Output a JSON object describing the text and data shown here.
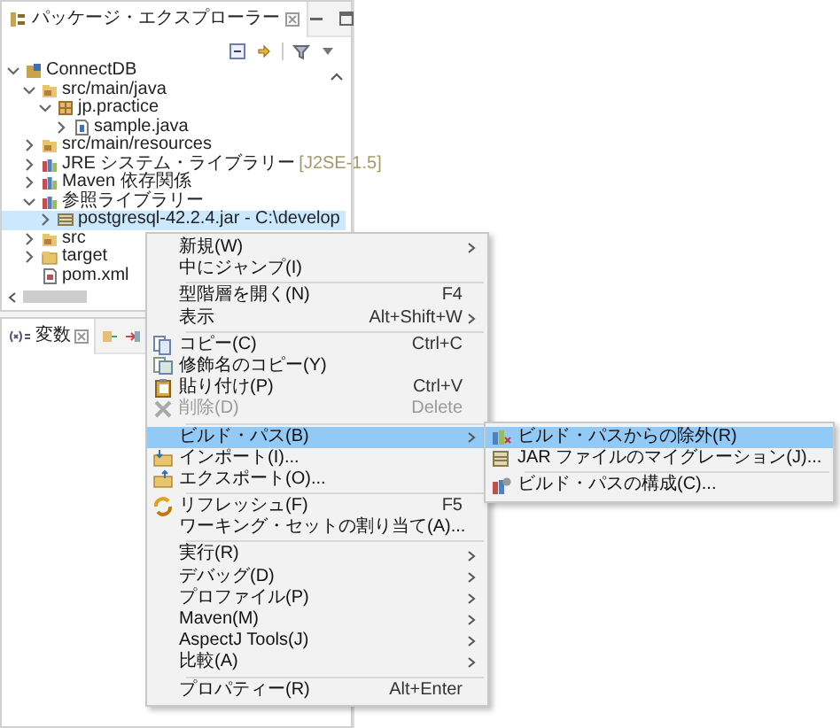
{
  "package_explorer": {
    "title": "パッケージ・エクスプローラー",
    "tree": [
      {
        "label": "ConnectDB",
        "kind": "project",
        "expanded": true,
        "selected": false,
        "children": [
          {
            "label": "src/main/java",
            "kind": "source-folder",
            "expanded": true,
            "selected": false,
            "children": [
              {
                "label": "jp.practice",
                "kind": "package",
                "expanded": true,
                "selected": false,
                "children": [
                  {
                    "label": "sample.java",
                    "kind": "java-file",
                    "expanded": false,
                    "selected": false
                  }
                ]
              }
            ]
          },
          {
            "label": "src/main/resources",
            "kind": "source-folder",
            "expanded": false,
            "selected": false
          },
          {
            "label": "JRE システム・ライブラリー",
            "decoration": "[J2SE-1.5]",
            "kind": "library",
            "expanded": false,
            "selected": false
          },
          {
            "label": "Maven 依存関係",
            "kind": "library",
            "expanded": false,
            "selected": false
          },
          {
            "label": "参照ライブラリー",
            "kind": "library",
            "expanded": true,
            "selected": false,
            "children": [
              {
                "label": "postgresql-42.2.4.jar - C:\\develop",
                "kind": "jar",
                "expanded": false,
                "selected": true
              }
            ]
          },
          {
            "label": "src",
            "kind": "source-folder",
            "expanded": false,
            "selected": false
          },
          {
            "label": "target",
            "kind": "folder",
            "expanded": false,
            "selected": false
          },
          {
            "label": "pom.xml",
            "kind": "xml-file",
            "selected": false
          }
        ]
      }
    ]
  },
  "variables_view": {
    "title": "変数"
  },
  "context_menu": {
    "items": [
      {
        "kind": "item",
        "label": "新規(W)",
        "submenu": true,
        "disabled": false,
        "selected": false
      },
      {
        "kind": "item",
        "label": "中にジャンプ(I)",
        "submenu": false,
        "disabled": false,
        "selected": false
      },
      {
        "kind": "separator"
      },
      {
        "kind": "item",
        "label": "型階層を開く(N)",
        "shortcut": "F4",
        "submenu": false,
        "disabled": false,
        "selected": false
      },
      {
        "kind": "item",
        "label": "表示",
        "shortcut": "Alt+Shift+W",
        "submenu": true,
        "disabled": false,
        "selected": false
      },
      {
        "kind": "separator"
      },
      {
        "kind": "item",
        "label": "コピー(C)",
        "shortcut": "Ctrl+C",
        "submenu": false,
        "disabled": false,
        "selected": false
      },
      {
        "kind": "item",
        "label": "修飾名のコピー(Y)",
        "submenu": false,
        "disabled": false,
        "selected": false
      },
      {
        "kind": "item",
        "label": "貼り付け(P)",
        "shortcut": "Ctrl+V",
        "submenu": false,
        "disabled": false,
        "selected": false
      },
      {
        "kind": "item",
        "label": "削除(D)",
        "shortcut": "Delete",
        "submenu": false,
        "disabled": true,
        "selected": false
      },
      {
        "kind": "separator"
      },
      {
        "kind": "item",
        "label": "ビルド・パス(B)",
        "submenu": true,
        "disabled": false,
        "selected": true
      },
      {
        "kind": "item",
        "label": "インポート(I)...",
        "submenu": false,
        "disabled": false,
        "selected": false
      },
      {
        "kind": "item",
        "label": "エクスポート(O)...",
        "submenu": false,
        "disabled": false,
        "selected": false
      },
      {
        "kind": "separator"
      },
      {
        "kind": "item",
        "label": "リフレッシュ(F)",
        "shortcut": "F5",
        "submenu": false,
        "disabled": false,
        "selected": false
      },
      {
        "kind": "item",
        "label": "ワーキング・セットの割り当て(A)...",
        "submenu": false,
        "disabled": false,
        "selected": false
      },
      {
        "kind": "separator"
      },
      {
        "kind": "item",
        "label": "実行(R)",
        "submenu": true,
        "disabled": false,
        "selected": false
      },
      {
        "kind": "item",
        "label": "デバッグ(D)",
        "submenu": true,
        "disabled": false,
        "selected": false
      },
      {
        "kind": "item",
        "label": "プロファイル(P)",
        "submenu": true,
        "disabled": false,
        "selected": false
      },
      {
        "kind": "item",
        "label": "Maven(M)",
        "submenu": true,
        "disabled": false,
        "selected": false
      },
      {
        "kind": "item",
        "label": "AspectJ Tools(J)",
        "submenu": true,
        "disabled": false,
        "selected": false
      },
      {
        "kind": "item",
        "label": "比較(A)",
        "submenu": true,
        "disabled": false,
        "selected": false
      },
      {
        "kind": "separator"
      },
      {
        "kind": "item",
        "label": "プロパティー(R)",
        "shortcut": "Alt+Enter",
        "submenu": false,
        "disabled": false,
        "selected": false
      }
    ]
  },
  "build_path_submenu": {
    "items": [
      {
        "kind": "item",
        "label": "ビルド・パスからの除外(R)",
        "selected": true
      },
      {
        "kind": "item",
        "label": "JAR ファイルのマイグレーション(J)...",
        "selected": false
      },
      {
        "kind": "separator"
      },
      {
        "kind": "item",
        "label": "ビルド・パスの構成(C)...",
        "selected": false
      }
    ]
  }
}
